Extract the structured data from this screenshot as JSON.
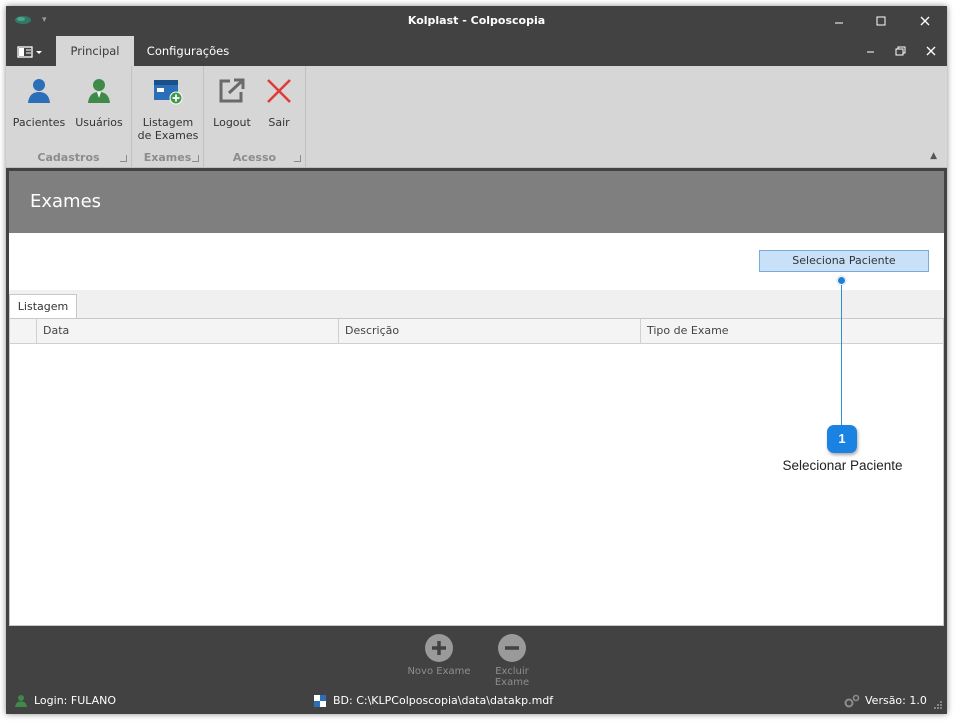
{
  "window": {
    "title": "Kolplast - Colposcopia"
  },
  "ribbon": {
    "tabs": [
      {
        "label": "Principal"
      },
      {
        "label": "Configurações"
      }
    ],
    "groups": [
      {
        "label": "Cadastros",
        "buttons": [
          {
            "label": "Pacientes",
            "icon": "user-icon"
          },
          {
            "label": "Usuários",
            "icon": "user-green-icon"
          }
        ]
      },
      {
        "label": "Exames",
        "buttons": [
          {
            "label": "Listagem\nde Exames",
            "icon": "exam-list-add-icon"
          }
        ]
      },
      {
        "label": "Acesso",
        "buttons": [
          {
            "label": "Logout",
            "icon": "logout-icon"
          },
          {
            "label": "Sair",
            "icon": "close-red-icon"
          }
        ]
      }
    ]
  },
  "page": {
    "title": "Exames",
    "select_patient_button": "Seleciona Paciente",
    "list_tab": "Listagem",
    "grid": {
      "columns": [
        "Data",
        "Descrição",
        "Tipo de Exame"
      ],
      "rows": []
    },
    "actions": [
      {
        "label": "Novo Exame",
        "icon": "plus-circle-icon"
      },
      {
        "label": "Excluir Exame",
        "icon": "minus-circle-icon"
      }
    ]
  },
  "status": {
    "login": "Login: FULANO",
    "db": "BD: C:\\KLPColposcopia\\data\\datakp.mdf",
    "version": "Versão: 1.0"
  },
  "annotation": {
    "number": "1",
    "text": "Selecionar Paciente"
  },
  "colors": {
    "accent": "#1a82e2",
    "chrome": "#424242",
    "ribbon": "#d6d6d6",
    "header_band": "#7f7f7f",
    "select_button": "#c8e0f8"
  }
}
